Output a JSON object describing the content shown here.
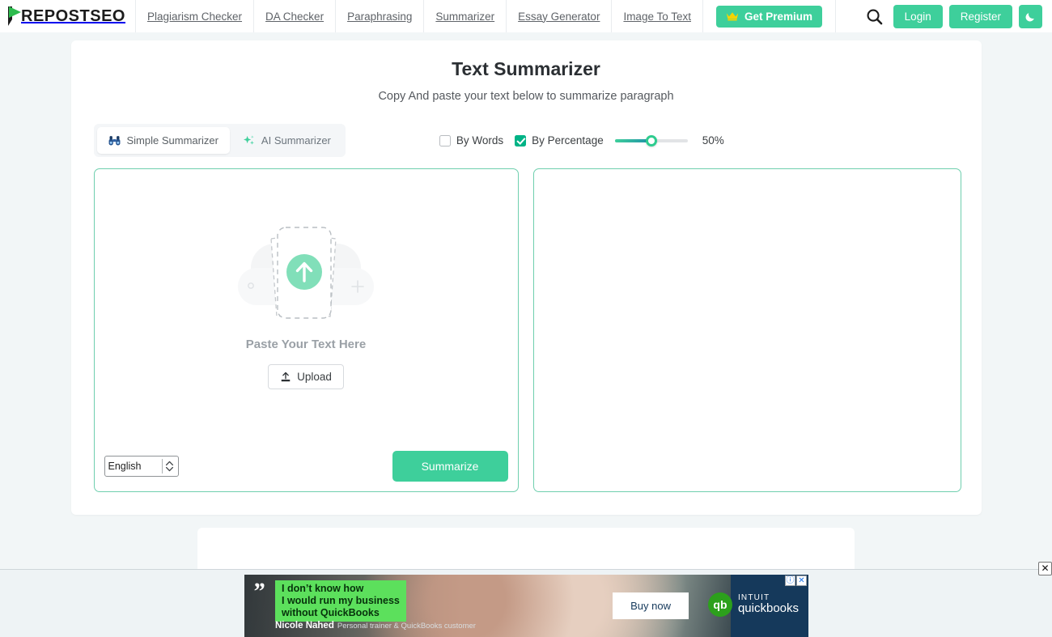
{
  "header": {
    "logo_text": "REPOSTSEO",
    "logo_full": "PREPOSTSEO",
    "nav": [
      {
        "label": "Plagiarism Checker"
      },
      {
        "label": "DA Checker"
      },
      {
        "label": "Paraphrasing"
      },
      {
        "label": "Summarizer"
      },
      {
        "label": "Essay Generator"
      },
      {
        "label": "Image To Text"
      }
    ],
    "premium_label": "Get Premium",
    "login_label": "Login",
    "register_label": "Register",
    "search_icon": "search-icon",
    "moon_icon": "moon-icon",
    "crown_icon": "crown-icon",
    "accent_green": "#3ecf9b",
    "crown_yellow": "#f5d400"
  },
  "main": {
    "title": "Text Summarizer",
    "subtitle": "Copy And paste your text below to summarize paragraph",
    "tabs": [
      {
        "label": "Simple Summarizer",
        "icon": "binoculars-icon",
        "active": true
      },
      {
        "label": "AI Summarizer",
        "icon": "sparkles-icon",
        "active": false
      }
    ],
    "options": {
      "by_words": {
        "label": "By Words",
        "checked": false
      },
      "by_percentage": {
        "label": "By Percentage",
        "checked": true
      },
      "slider_value": 50,
      "slider_min": 0,
      "slider_max": 100,
      "percent_label": "50%"
    },
    "input_panel": {
      "paste_label": "Paste Your Text Here",
      "upload_label": "Upload",
      "upload_icon": "upload-icon",
      "language_value": "English",
      "language_options": [
        "English"
      ],
      "summarize_label": "Summarize"
    },
    "output_panel": {
      "content": ""
    },
    "border_green": "#6fcfae"
  },
  "ad": {
    "quote_mark": "”",
    "headline_lines": [
      "I don’t know how",
      "I would run my business",
      "without QuickBooks"
    ],
    "byline_name": "Nicole Nahed",
    "byline_role": "Personal trainer & QuickBooks customer",
    "cta_label": "Buy now",
    "brand_top": "INTUIT",
    "brand_bottom": "quickbooks",
    "brand_mark": "qb",
    "info_badge": "ⓘ",
    "close_badge": "✕",
    "close_label": "✕",
    "bubble_green": "#5ce05c",
    "panel_navy": "#15395b"
  }
}
